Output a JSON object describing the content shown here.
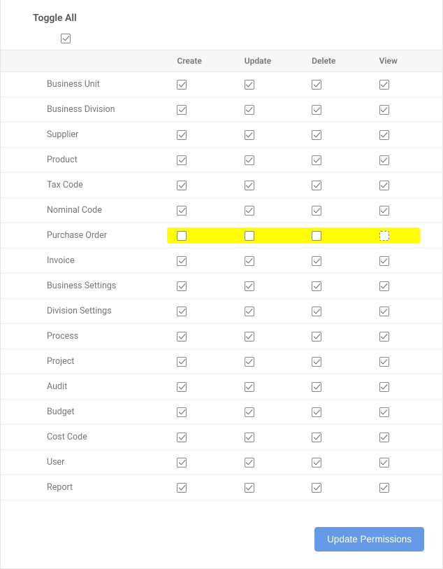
{
  "toggleAllLabel": "Toggle All",
  "toggleAllChecked": true,
  "columns": [
    "Create",
    "Update",
    "Delete",
    "View"
  ],
  "rows": [
    {
      "name": "Business Unit",
      "perms": [
        true,
        true,
        true,
        true
      ],
      "highlighted": false
    },
    {
      "name": "Business Division",
      "perms": [
        true,
        true,
        true,
        true
      ],
      "highlighted": false
    },
    {
      "name": "Supplier",
      "perms": [
        true,
        true,
        true,
        true
      ],
      "highlighted": false
    },
    {
      "name": "Product",
      "perms": [
        true,
        true,
        true,
        true
      ],
      "highlighted": false
    },
    {
      "name": "Tax Code",
      "perms": [
        true,
        true,
        true,
        true
      ],
      "highlighted": false
    },
    {
      "name": "Nominal Code",
      "perms": [
        true,
        true,
        true,
        true
      ],
      "highlighted": false
    },
    {
      "name": "Purchase Order",
      "perms": [
        false,
        false,
        false,
        false
      ],
      "highlighted": true,
      "lastDotted": true
    },
    {
      "name": "Invoice",
      "perms": [
        true,
        true,
        true,
        true
      ],
      "highlighted": false
    },
    {
      "name": "Business Settings",
      "perms": [
        true,
        true,
        true,
        true
      ],
      "highlighted": false
    },
    {
      "name": "Division Settings",
      "perms": [
        true,
        true,
        true,
        true
      ],
      "highlighted": false
    },
    {
      "name": "Process",
      "perms": [
        true,
        true,
        true,
        true
      ],
      "highlighted": false
    },
    {
      "name": "Project",
      "perms": [
        true,
        true,
        true,
        true
      ],
      "highlighted": false
    },
    {
      "name": "Audit",
      "perms": [
        true,
        true,
        true,
        true
      ],
      "highlighted": false
    },
    {
      "name": "Budget",
      "perms": [
        true,
        true,
        true,
        true
      ],
      "highlighted": false
    },
    {
      "name": "Cost Code",
      "perms": [
        true,
        true,
        true,
        true
      ],
      "highlighted": false
    },
    {
      "name": "User",
      "perms": [
        true,
        true,
        true,
        true
      ],
      "highlighted": false
    },
    {
      "name": "Report",
      "perms": [
        true,
        true,
        true,
        true
      ],
      "highlighted": false
    }
  ],
  "updateButtonLabel": "Update Permissions"
}
